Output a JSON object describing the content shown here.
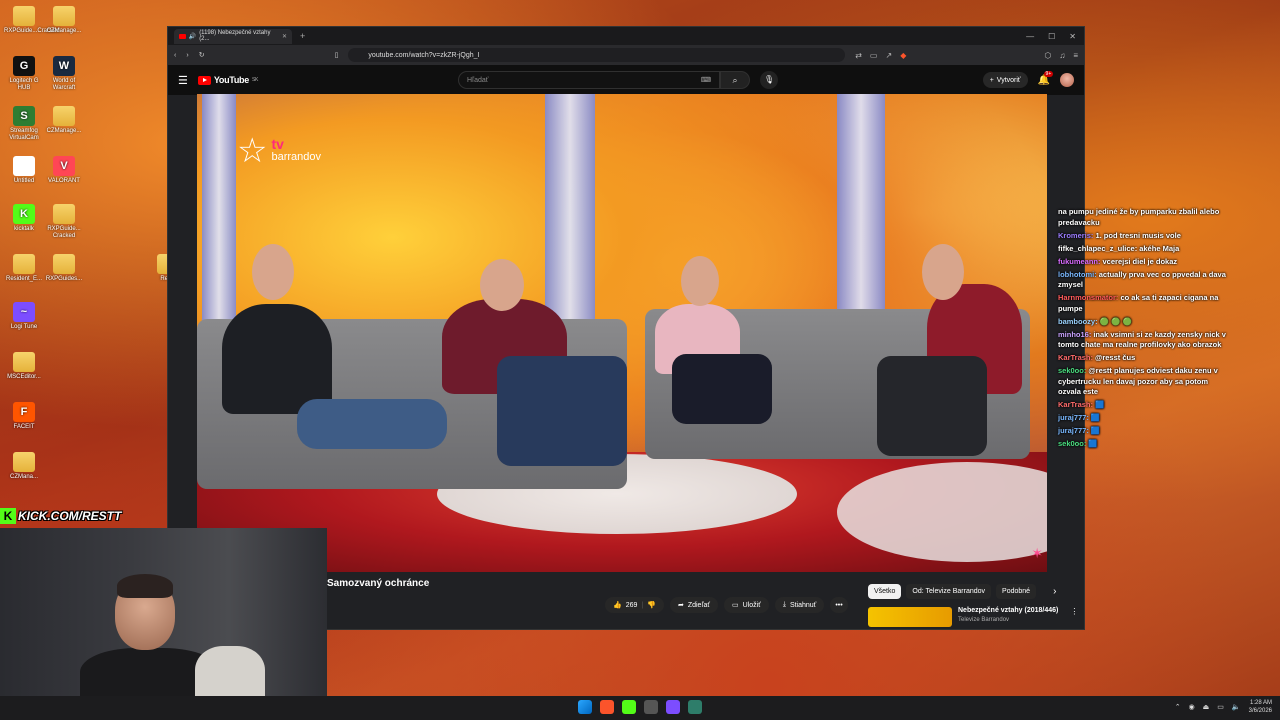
{
  "desktop": {
    "icons": [
      {
        "label": "RXPGuide...Cracked",
        "glyph": "",
        "color": "#f0c040"
      },
      {
        "label": "CZManage...",
        "glyph": "",
        "color": "#f0c040"
      },
      {
        "label": "Logitech G HUB",
        "glyph": "G",
        "color": "#111111"
      },
      {
        "label": "World of Warcraft",
        "glyph": "W",
        "color": "#1a2a40"
      },
      {
        "label": "Streamfog VirtualCam",
        "glyph": "S",
        "color": "#2e7d32"
      },
      {
        "label": "CZManage...",
        "glyph": "",
        "color": "#f0c040"
      },
      {
        "label": "Untitled",
        "glyph": "",
        "color": "#ffffff"
      },
      {
        "label": "VALORANT",
        "glyph": "V",
        "color": "#ff4655"
      },
      {
        "label": "kicktalk",
        "glyph": "K",
        "color": "#53fc18"
      },
      {
        "label": "RXPGuide... Cracked",
        "glyph": "",
        "color": "#f0c040"
      },
      {
        "label": "Resident_E...",
        "glyph": "",
        "color": "#f0c040"
      },
      {
        "label": "RXPGuides...",
        "glyph": "",
        "color": "#f0c040"
      },
      {
        "label": "Logi Tune",
        "glyph": "~",
        "color": "#7c4dff"
      },
      {
        "label": "MSCEditor...",
        "glyph": "",
        "color": "#f0c040"
      },
      {
        "label": "FACEIT",
        "glyph": "F",
        "color": "#ff5500"
      },
      {
        "label": "CZMana...",
        "glyph": "",
        "color": "#f0c040"
      },
      {
        "label": "Resid",
        "glyph": "",
        "color": "#f0c040"
      }
    ]
  },
  "browser": {
    "tab_title": "(1198) Nebezpečné vztahy (2...",
    "url": "youtube.com/watch?v=zkZR-jQgh_I",
    "window_controls": [
      "—",
      "☐",
      "✕"
    ]
  },
  "youtube": {
    "logo": "YouTube",
    "region": "SK",
    "search_placeholder": "Hľadať",
    "create_label": "Vytvoriť",
    "notif_count": "9+",
    "video": {
      "channel_logo_tv": "tv",
      "channel_logo_name": "barrandov"
    },
    "title": "Samozvaný ochránce",
    "actions": {
      "likes": "269",
      "share": "Zdieľať",
      "save": "Uložiť",
      "download": "Stiahnuť"
    },
    "chips": [
      "Všetko",
      "Od: Televize Barrandov",
      "Podobné"
    ],
    "related": {
      "title": "Nebezpečné vztahy (2018/446)",
      "channel": "Televize Barrandov"
    }
  },
  "chat": [
    {
      "user": "",
      "color": "#ffffff",
      "text": "na pumpu jediné že by pumparku zbalil alebo predavacku"
    },
    {
      "user": "Kromeris:",
      "color": "#9b7dff",
      "text": "1. pod tresni musis vole"
    },
    {
      "user": "fifke_chlapec_z_ulice:",
      "color": "#ffffff",
      "text": "akéhe Maja"
    },
    {
      "user": "fukumeann:",
      "color": "#d86bff",
      "text": "vcerejsi diel je dokaz"
    },
    {
      "user": "lobhotomi:",
      "color": "#7ab8ff",
      "text": "actually prva vec co ppvedal a dava zmysel"
    },
    {
      "user": "Harnmonsmator:",
      "color": "#ff5a5a",
      "text": "co ak sa ti zapaci cigana na pumpe"
    },
    {
      "user": "bamboozy:",
      "color": "#9bd3ff",
      "text": "🟢 🟢 🟢"
    },
    {
      "user": "minho16:",
      "color": "#c9a3ff",
      "text": "inak vsimni si ze kazdy zensky nick v tomto chate ma realne profilovky ako obrazok"
    },
    {
      "user": "KarTrash:",
      "color": "#ff6b6b",
      "text": "@resst čus"
    },
    {
      "user": "sek0oo:",
      "color": "#4ade80",
      "text": "@restt planujes odviest daku zenu v cybertrucku len davaj pozor aby sa potom ozvala este"
    },
    {
      "user": "KarTrash:",
      "color": "#ff6b6b",
      "text": "🟦"
    },
    {
      "user": "juraj777:",
      "color": "#7ab8ff",
      "text": "🟦"
    },
    {
      "user": "juraj777:",
      "color": "#7ab8ff",
      "text": "🟦"
    },
    {
      "user": "sek0oo:",
      "color": "#4ade80",
      "text": "🟦"
    }
  ],
  "overlay": {
    "kick_text": "KICK.COM/RESTT"
  },
  "taskbar": {
    "time": "1:28 AM",
    "date": "3/6/2026"
  }
}
